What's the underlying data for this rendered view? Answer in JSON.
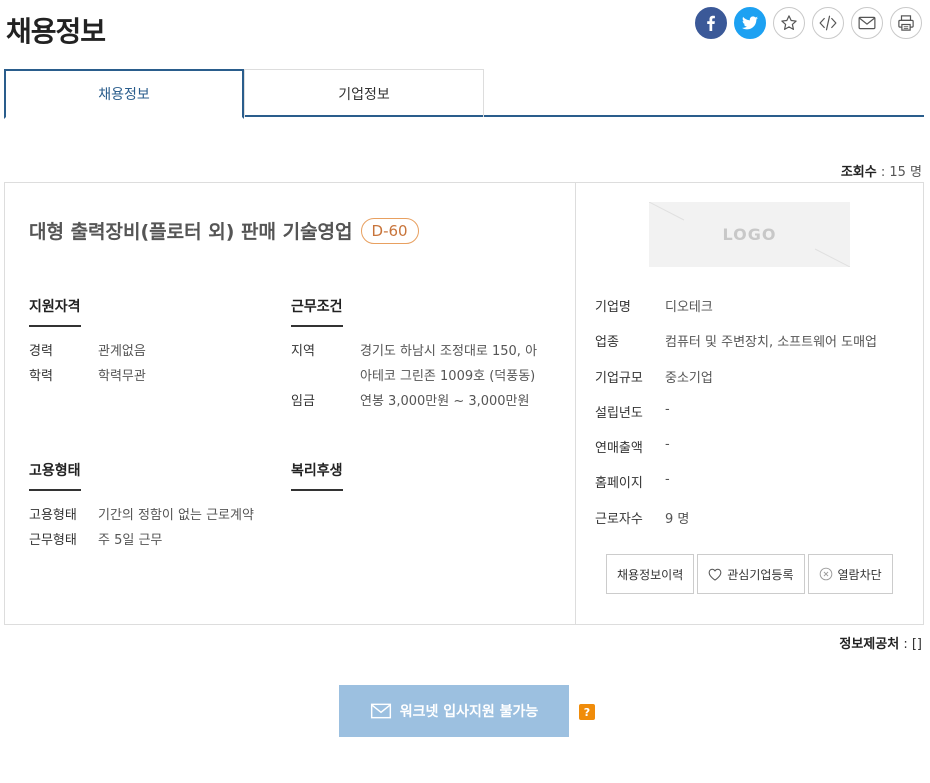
{
  "page": {
    "title": "채용정보"
  },
  "share": {
    "icons": [
      "facebook-icon",
      "twitter-icon",
      "star-icon",
      "embed-code-icon",
      "mail-icon",
      "print-icon"
    ]
  },
  "tabs": [
    {
      "label": "채용정보",
      "active": true
    },
    {
      "label": "기업정보",
      "active": false
    }
  ],
  "views": {
    "label": "조회수",
    "value": "15 명"
  },
  "job": {
    "title": "대형 출력장비(플로터 외) 판매 기술영업",
    "dday": "D-60"
  },
  "qualification": {
    "title": "지원자격",
    "rows": [
      {
        "k": "경력",
        "v": "관계없음"
      },
      {
        "k": "학력",
        "v": "학력무관"
      }
    ]
  },
  "conditions": {
    "title": "근무조건",
    "rows": [
      {
        "k": "지역",
        "v": "경기도 하남시 조정대로 150, 아"
      },
      {
        "k": "",
        "v": "아테코 그린존 1009호 (덕풍동)"
      },
      {
        "k": "임금",
        "v": "연봉 3,000만원 ~ 3,000만원"
      }
    ]
  },
  "employment": {
    "title": "고용형태",
    "rows": [
      {
        "k": "고용형태",
        "v": "기간의 정함이 없는 근로계약"
      },
      {
        "k": "근무형태",
        "v": "주 5일 근무"
      }
    ]
  },
  "welfare": {
    "title": "복리후생"
  },
  "company": {
    "logo_text": "LOGO",
    "rows": [
      {
        "k": "기업명",
        "v": "디오테크"
      },
      {
        "k": "업종",
        "v": "컴퓨터 및 주변장치, 소프트웨어 도매업"
      },
      {
        "k": "기업규모",
        "v": "중소기업"
      },
      {
        "k": "설립년도",
        "v": "-"
      },
      {
        "k": "연매출액",
        "v": "-"
      },
      {
        "k": "홈페이지",
        "v": "-"
      },
      {
        "k": "근로자수",
        "v": "9 명"
      }
    ],
    "buttons": {
      "history": "채용정보이력",
      "favorite": "관심기업등록",
      "block": "열람차단"
    }
  },
  "provider": {
    "label": "정보제공처",
    "value": "[]"
  },
  "apply": {
    "label": "워크넷 입사지원 불가능",
    "help": "?"
  }
}
